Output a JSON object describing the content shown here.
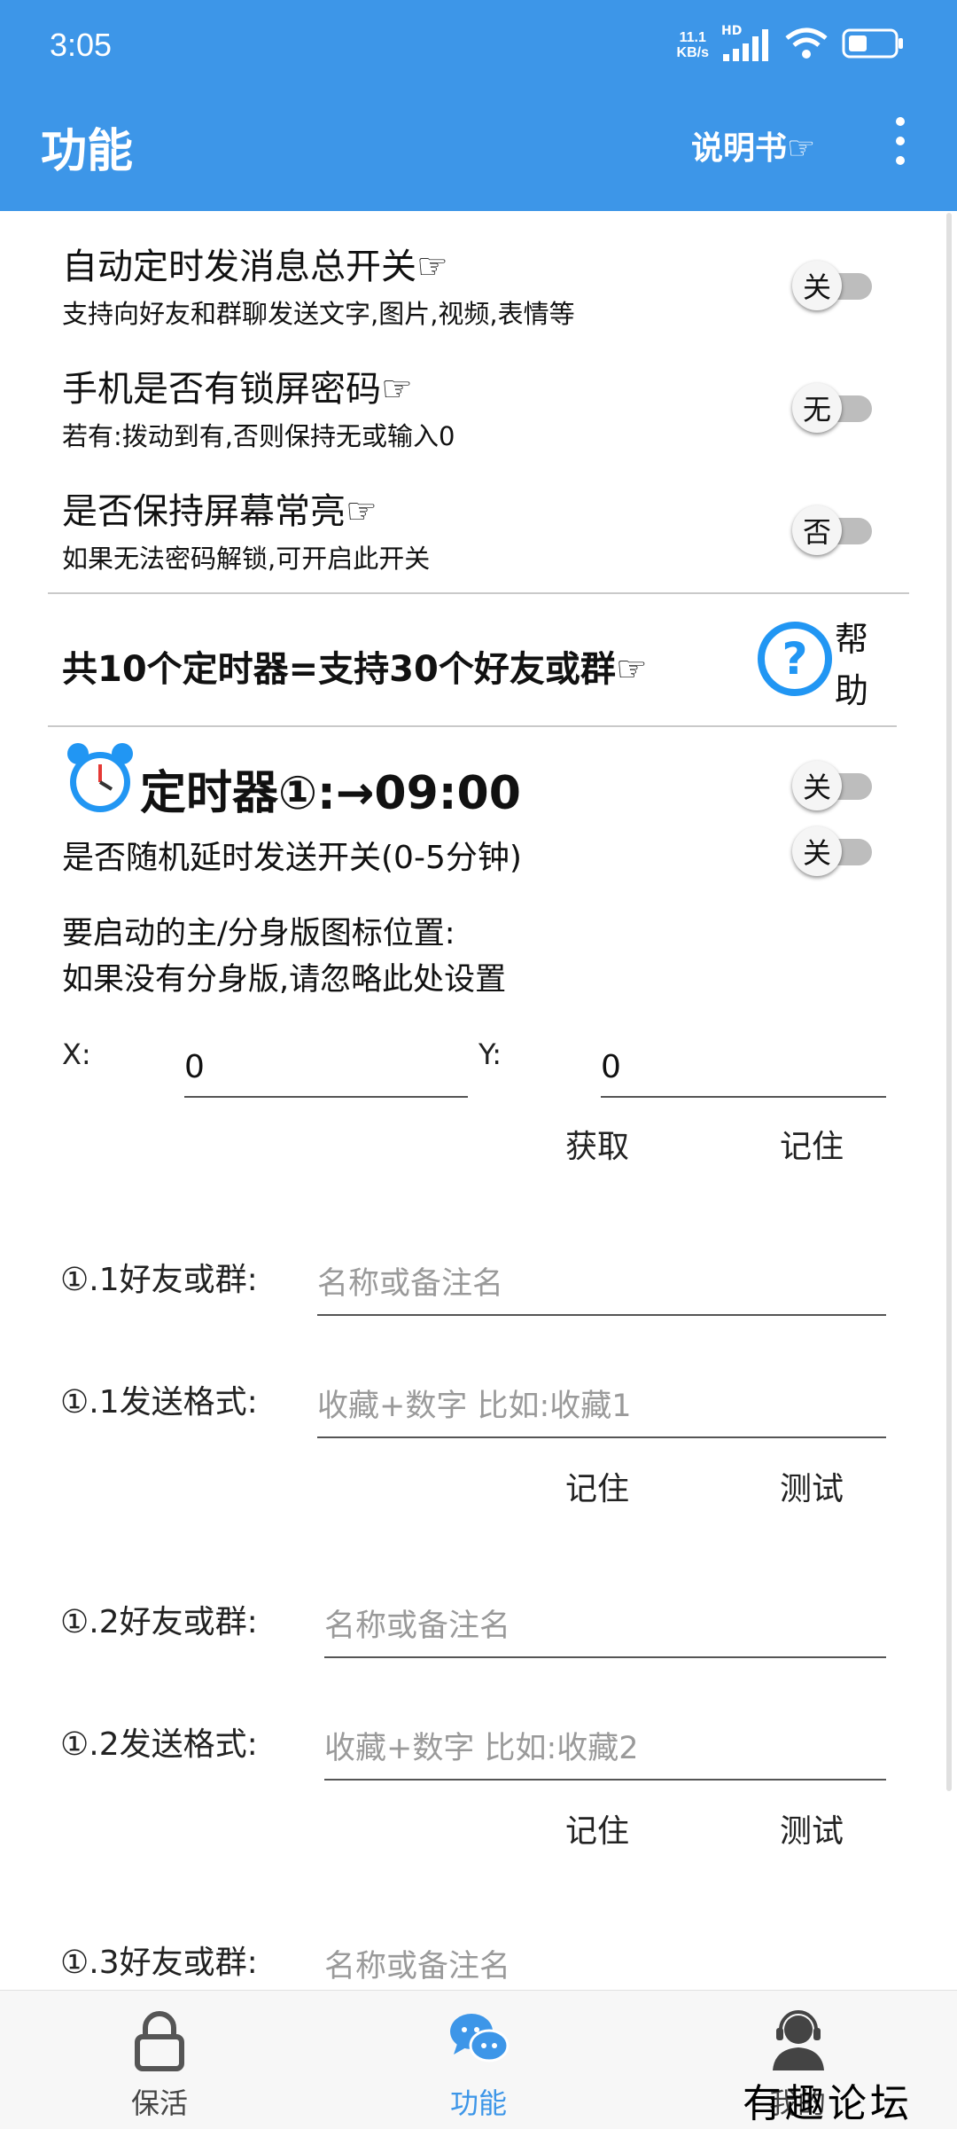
{
  "status_bar": {
    "time": "3:05",
    "net_speed_value": "11.1",
    "net_speed_unit": "KB/s",
    "signal_badge": "HD"
  },
  "appbar": {
    "title": "功能",
    "manual_label": "说明书☞",
    "more_icon": "more-vert-icon",
    "color": "#3d96e8"
  },
  "switches": [
    {
      "title": "自动定时发消息总开关☞",
      "desc": "支持向好友和群聊发送文字,图片,视频,表情等",
      "state": "关"
    },
    {
      "title": "手机是否有锁屏密码☞",
      "desc": "若有:拨动到有,否则保持无或输入0",
      "state": "无"
    },
    {
      "title": "是否保持屏幕常亮☞",
      "desc": "如果无法密码解锁,可开启此开关",
      "state": "否"
    }
  ],
  "timer_banner": {
    "text": "共10个定时器=支持30个好友或群☞",
    "help_label": "帮助",
    "help_icon": "help-circle-icon"
  },
  "timer1": {
    "title": "定时器①:→09:00",
    "alarm_icon": "alarm-clock-icon",
    "state": "关",
    "random_delay_label": "是否随机延时发送开关(0-5分钟)",
    "random_delay_state": "关",
    "position_note_1": "要启动的主/分身版图标位置:",
    "position_note_2": "如果没有分身版,请忽略此处设置",
    "x_label": "X:",
    "x_value": "0",
    "y_label": "Y:",
    "y_value": "0",
    "get_label": "获取",
    "remember_label": "记住"
  },
  "targets": [
    {
      "friend_label": "①.1好友或群:",
      "friend_placeholder": "名称或备注名",
      "format_label": "①.1发送格式:",
      "format_placeholder": "收藏+数字 比如:收藏1",
      "remember": "记住",
      "test": "测试"
    },
    {
      "friend_label": "①.2好友或群:",
      "friend_placeholder": "名称或备注名",
      "format_label": "①.2发送格式:",
      "format_placeholder": "收藏+数字 比如:收藏2",
      "remember": "记住",
      "test": "测试"
    },
    {
      "friend_label": "①.3好友或群:",
      "friend_placeholder": "名称或备注名"
    }
  ],
  "bottom_nav": [
    {
      "label": "保活",
      "icon": "lock-icon",
      "active": false
    },
    {
      "label": "功能",
      "icon": "chat-bubbles-icon",
      "active": true
    },
    {
      "label": "我的",
      "icon": "headset-user-icon",
      "active": false
    }
  ],
  "watermark": "有趣论坛"
}
